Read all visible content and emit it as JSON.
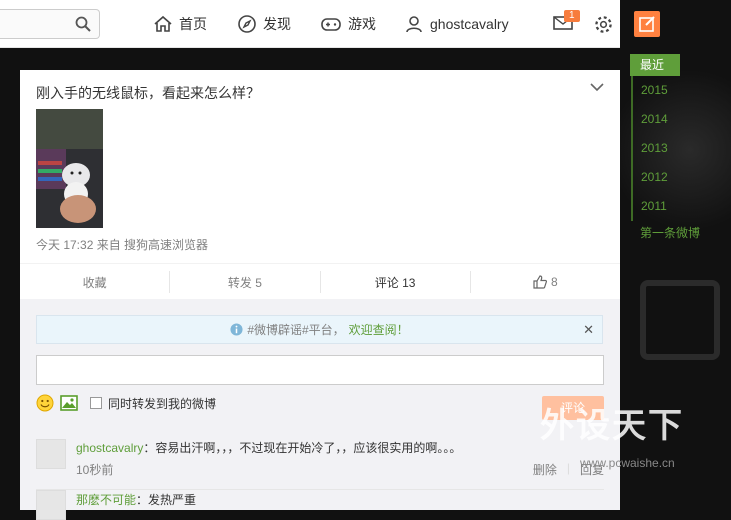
{
  "nav": {
    "home": "首页",
    "discover": "发现",
    "games": "游戏",
    "user": "ghostcavalry",
    "mail_count": "1"
  },
  "timeline": {
    "current": "最近",
    "years": [
      "2015",
      "2014",
      "2013",
      "2012",
      "2011"
    ],
    "first": "第一条微博"
  },
  "post": {
    "text": "刚入手的无线鼠标，看起来怎么样？",
    "meta": "今天 17:32 来自 搜狗高速浏览器",
    "actions": {
      "favorite": "收藏",
      "repost": "转发 5",
      "comment": "评论 13",
      "like": "8"
    }
  },
  "comment_box": {
    "notice_prefix": "#微博辟谣#平台，",
    "notice_link": "欢迎查阅！",
    "repost_option": "同时转发到我的微博",
    "submit": "评论"
  },
  "comments": [
    {
      "user": "ghostcavalry",
      "text": "：容易出汗啊，，，不过现在开始冷了，，应该很实用的啊。。。",
      "time": "10秒前",
      "delete": "删除",
      "reply": "回复"
    },
    {
      "user": "那麽不可能",
      "text": "：发热严重"
    }
  ],
  "watermark": {
    "main": "外设天下",
    "url": "www.pcwaishe.cn"
  },
  "colors": {
    "accent_green": "#5f9e3a",
    "orange": "#ff8140"
  }
}
